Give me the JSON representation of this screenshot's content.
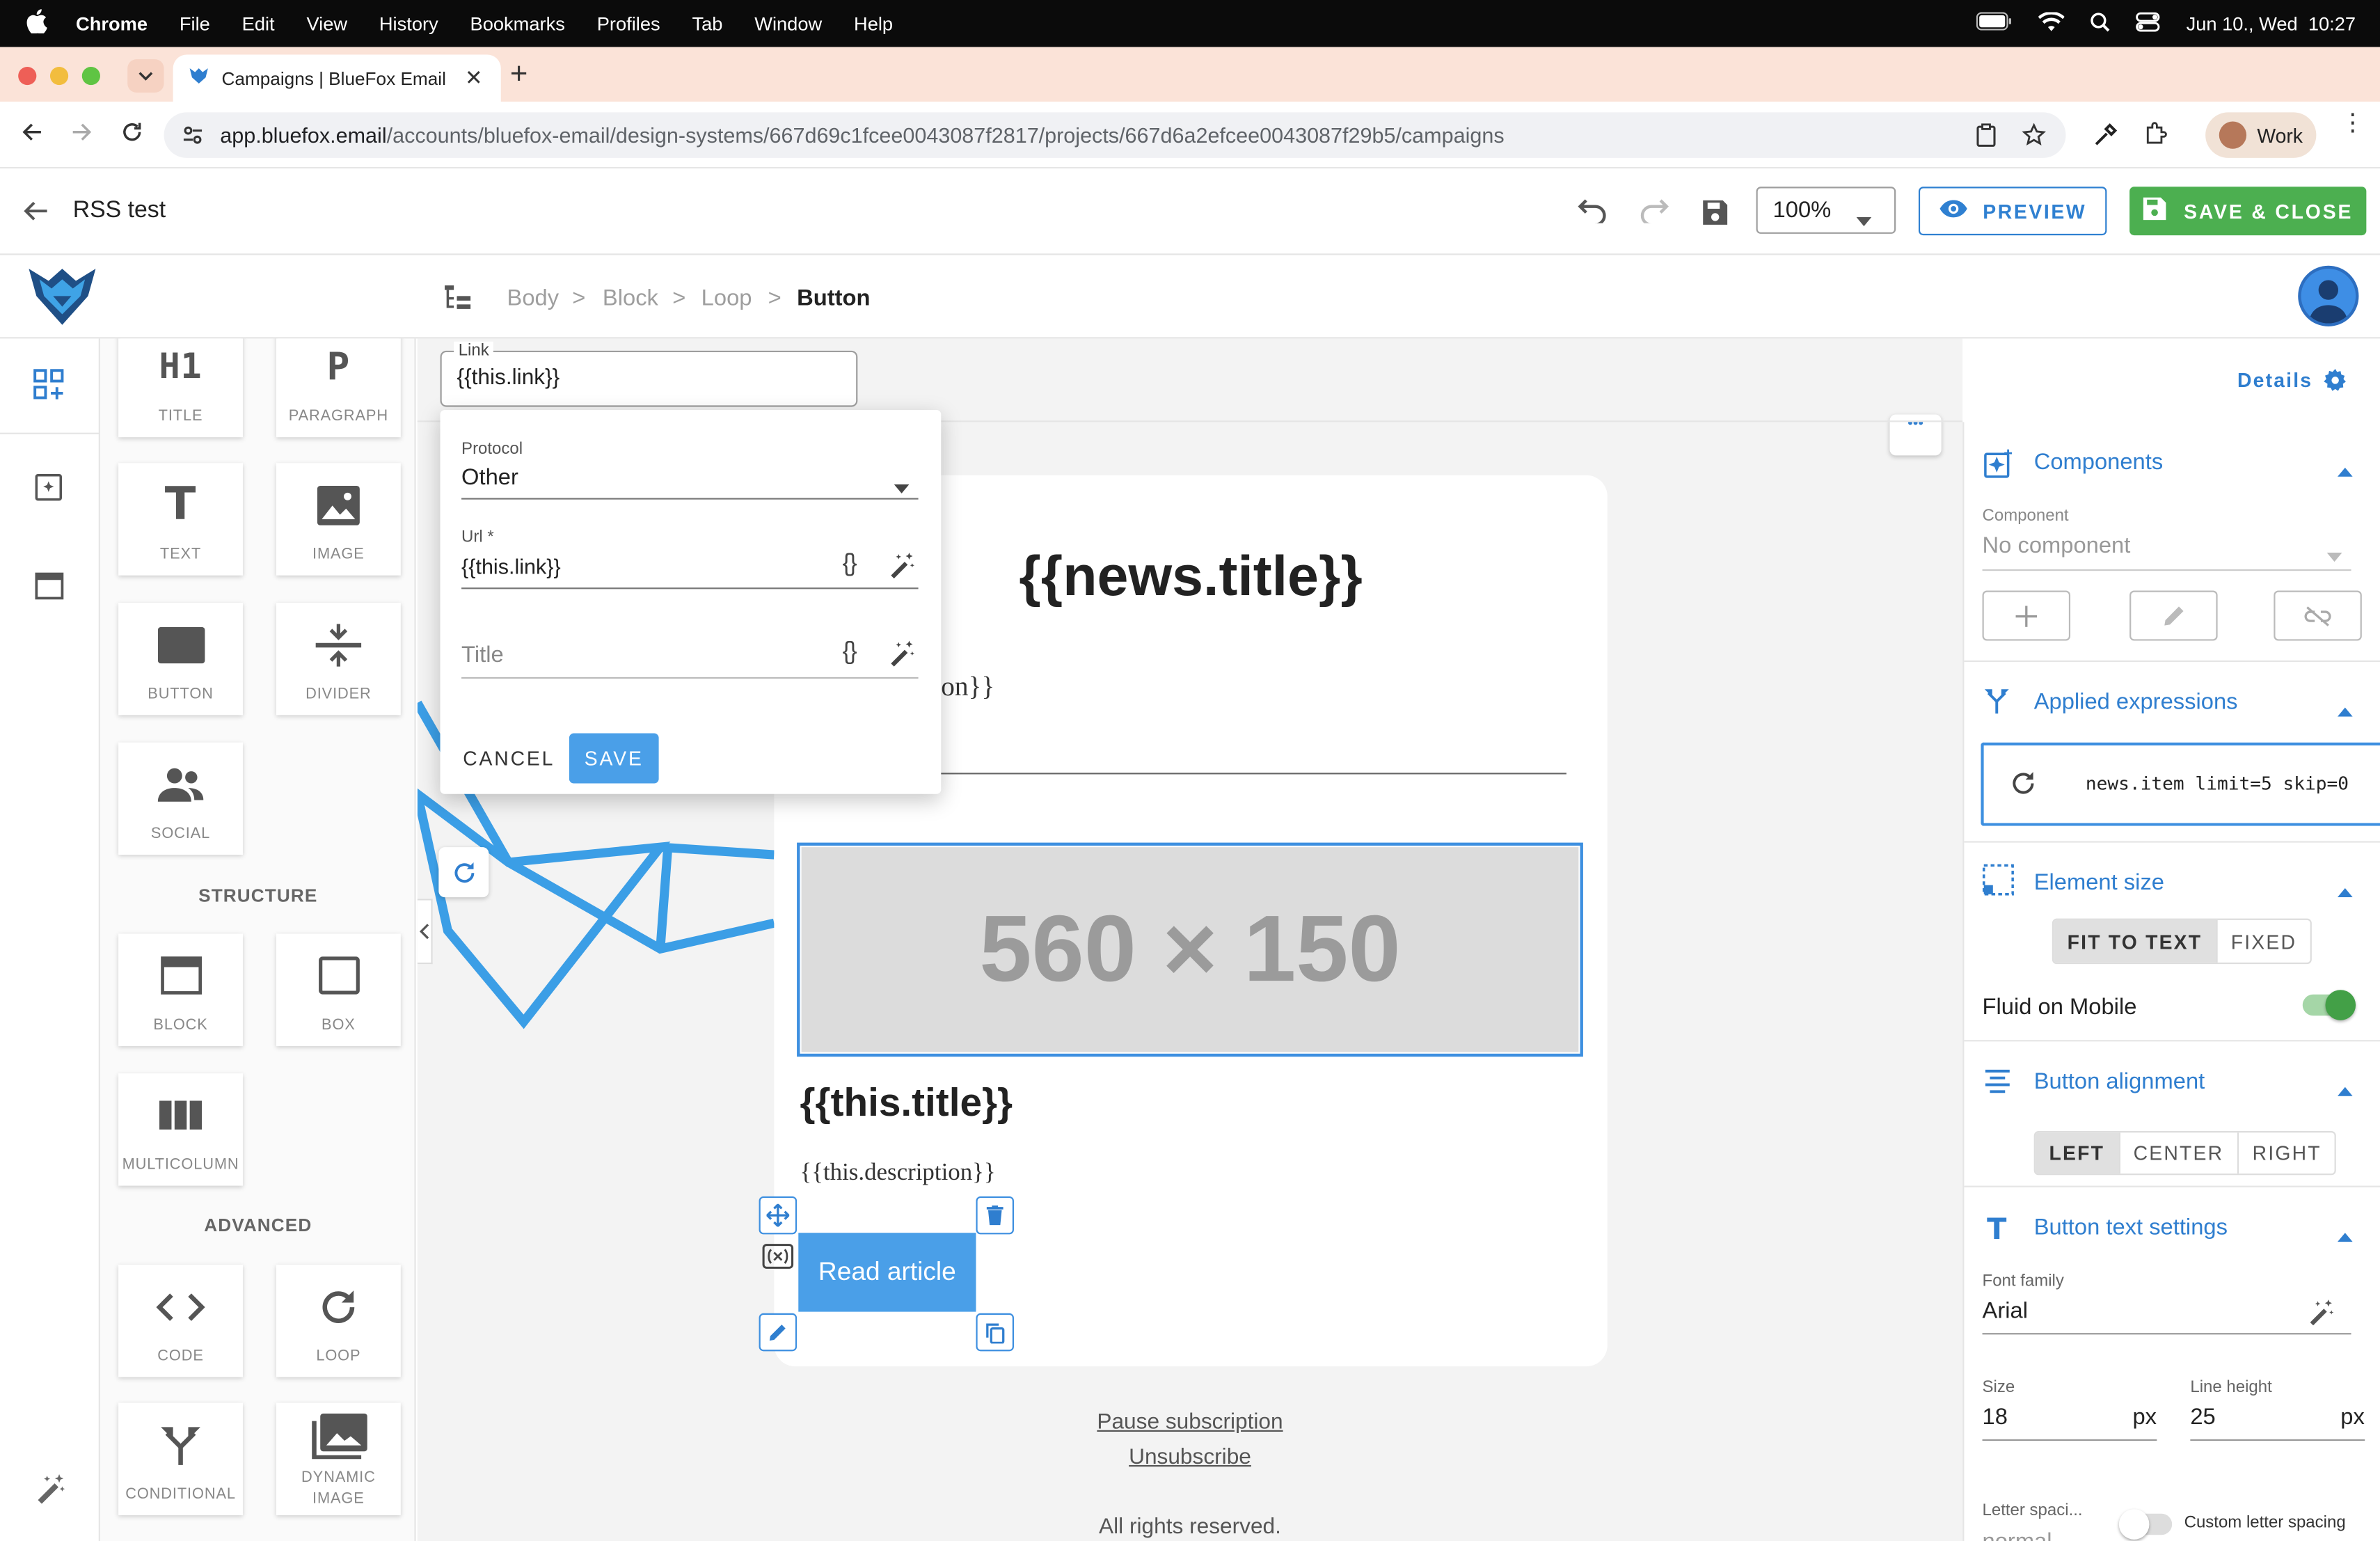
{
  "menubar": {
    "app": "Chrome",
    "items": [
      "File",
      "Edit",
      "View",
      "History",
      "Bookmarks",
      "Profiles",
      "Tab",
      "Window",
      "Help"
    ],
    "datetime": "Jun 10., Wed  10:27"
  },
  "browser": {
    "tab_title": "Campaigns | BlueFox Email",
    "url_host": "app.bluefox.email",
    "url_path": "/accounts/bluefox-email/design-systems/667d69c1fcee0043087f2817/projects/667d6a2efcee0043087f29b5/campaigns",
    "profile": "Work"
  },
  "header": {
    "title": "RSS test",
    "zoom": "100%",
    "preview_label": "PREVIEW",
    "save_close_label": "SAVE & CLOSE"
  },
  "breadcrumb": [
    "Body",
    "Block",
    "Loop",
    "Button"
  ],
  "palette": {
    "basic": [
      {
        "glyph": "H1",
        "label": "TITLE"
      },
      {
        "glyph": "P",
        "label": "PARAGRAPH"
      },
      {
        "glyph": "T",
        "label": "TEXT"
      },
      {
        "glyph": "image",
        "label": "IMAGE"
      },
      {
        "glyph": "button",
        "label": "BUTTON"
      },
      {
        "glyph": "divider",
        "label": "DIVIDER"
      },
      {
        "glyph": "social",
        "label": "SOCIAL"
      }
    ],
    "structure_title": "STRUCTURE",
    "structure": [
      {
        "label": "BLOCK"
      },
      {
        "label": "BOX"
      },
      {
        "label": "MULTICOLUMN"
      }
    ],
    "advanced_title": "ADVANCED",
    "advanced": [
      {
        "label": "CODE"
      },
      {
        "label": "LOOP"
      },
      {
        "label": "CONDITIONAL"
      },
      {
        "label": "DYNAMIC IMAGE"
      }
    ]
  },
  "link_popup": {
    "field_label": "Link",
    "field_value": "{{this.link}}",
    "protocol_label": "Protocol",
    "protocol_value": "Other",
    "url_label": "Url *",
    "url_value": "{{this.link}}",
    "title_placeholder": "Title",
    "cancel_label": "CANCEL",
    "save_label": "SAVE",
    "braces": "{}"
  },
  "canvas": {
    "news_title": "{{news.title}}",
    "description_partial": "ription}}",
    "placeholder_image": "560 × 150",
    "item_title": "{{this.title}}",
    "item_description": "{{this.description}}",
    "button_label": "Read article",
    "pause_link": "Pause subscription",
    "unsubscribe_link": "Unsubscribe",
    "rights": "All rights reserved.",
    "more_dots": "•••"
  },
  "right_panel": {
    "details_label": "Details",
    "components": {
      "title": "Components",
      "field_label": "Component",
      "field_value": "No component"
    },
    "applied_expressions": {
      "title": "Applied expressions",
      "expression": "news.item limit=5 skip=0"
    },
    "element_size": {
      "title": "Element size",
      "options": [
        "FIT TO TEXT",
        "FIXED"
      ],
      "selected": "FIT TO TEXT",
      "fluid_label": "Fluid on Mobile",
      "fluid_on": true
    },
    "button_alignment": {
      "title": "Button alignment",
      "options": [
        "LEFT",
        "CENTER",
        "RIGHT"
      ],
      "selected": "LEFT"
    },
    "button_text": {
      "title": "Button text settings",
      "font_family_label": "Font family",
      "font_family_value": "Arial",
      "size_label": "Size",
      "size_value": "18",
      "line_height_label": "Line height",
      "line_height_value": "25",
      "unit": "px",
      "letter_spacing_label": "Letter spaci...",
      "letter_spacing_value": "normal",
      "custom_spacing_label": "Custom letter spacing"
    }
  },
  "colors": {
    "accent": "#2f7ecf",
    "green": "#4caf50",
    "button_blue": "#4a9fe8",
    "tab_strip": "#fbe3d8"
  }
}
